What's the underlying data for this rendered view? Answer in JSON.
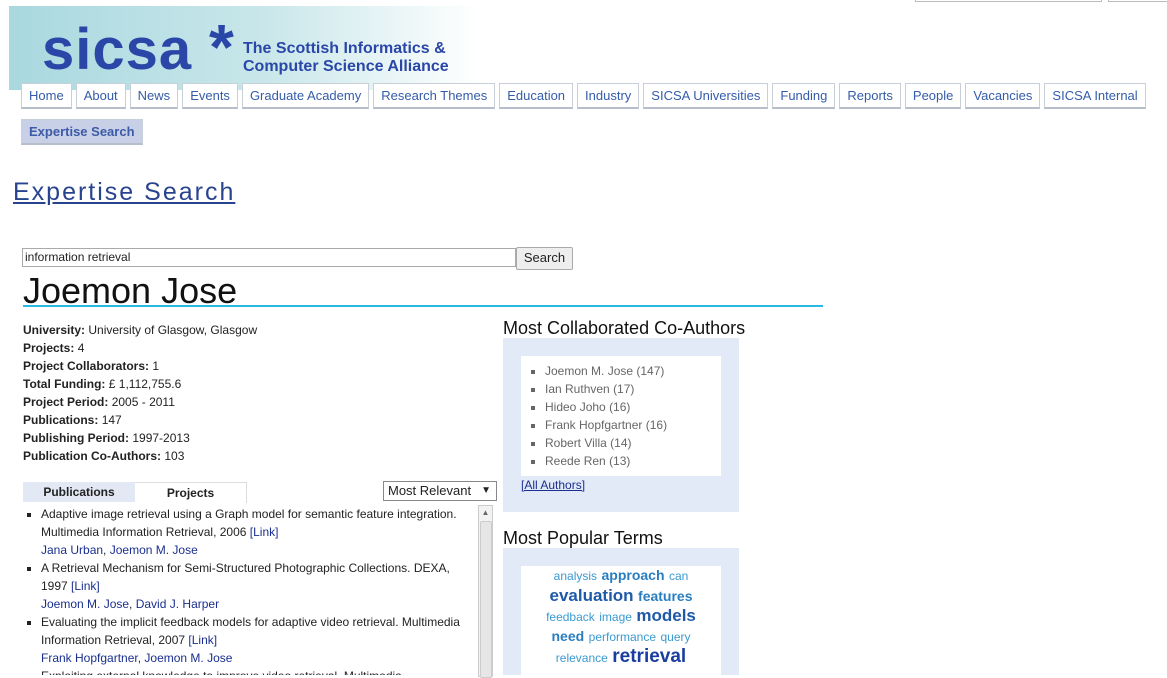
{
  "site": {
    "logo_text": "sicsa",
    "logo_star": "*",
    "tagline_1": "The Scottish Informatics &",
    "tagline_2": "Computer Science Alliance"
  },
  "nav": [
    "Home",
    "About",
    "News",
    "Events",
    "Graduate Academy",
    "Research Themes",
    "Education",
    "Industry",
    "SICSA Universities",
    "Funding",
    "Reports",
    "People",
    "Vacancies",
    "SICSA Internal"
  ],
  "nav_active": "Expertise Search",
  "page_title": "Expertise Search",
  "search": {
    "value": "information retrieval",
    "button": "Search"
  },
  "person": {
    "name": "Joemon Jose",
    "fields": [
      {
        "label": "University:",
        "value": "University of Glasgow, Glasgow"
      },
      {
        "label": "Projects:",
        "value": "4"
      },
      {
        "label": "Project Collaborators:",
        "value": "1"
      },
      {
        "label": "Total Funding:",
        "value": "£ 1,112,755.6"
      },
      {
        "label": "Project Period:",
        "value": "2005 - 2011"
      },
      {
        "label": "Publications:",
        "value": "147"
      },
      {
        "label": "Publishing Period:",
        "value": "1997-2013"
      },
      {
        "label": "Publication Co-Authors:",
        "value": "103"
      }
    ]
  },
  "tabs": {
    "publications": "Publications",
    "projects": "Projects"
  },
  "sort": {
    "selected": "Most Relevant"
  },
  "publications": [
    {
      "text": "Adaptive image retrieval using a Graph model for semantic feature integration. Multimedia Information Retrieval, 2006",
      "link": "[Link]",
      "authors": [
        "Jana Urban",
        "Joemon M. Jose"
      ]
    },
    {
      "text": "A Retrieval Mechanism for Semi-Structured Photographic Collections. DEXA, 1997",
      "link": "[Link]",
      "authors": [
        "Joemon M. Jose",
        "David J. Harper"
      ]
    },
    {
      "text": "Evaluating the implicit feedback models for adaptive video retrieval. Multimedia Information Retrieval, 2007",
      "link": "[Link]",
      "authors": [
        "Frank Hopfgartner",
        "Joemon M. Jose"
      ]
    },
    {
      "text": "Exploiting external knowledge to improve video retrieval. Multimedia",
      "link": "",
      "authors": []
    }
  ],
  "coauthors": {
    "title": "Most Collaborated Co-Authors",
    "items": [
      {
        "name": "Joemon M. Jose",
        "count": "(147)"
      },
      {
        "name": "Ian Ruthven",
        "count": "(17)"
      },
      {
        "name": "Hideo Joho",
        "count": "(16)"
      },
      {
        "name": "Frank Hopfgartner",
        "count": "(16)"
      },
      {
        "name": "Robert Villa",
        "count": "(14)"
      },
      {
        "name": "Reede Ren",
        "count": "(13)"
      }
    ],
    "all_link": "[All Authors]"
  },
  "terms": {
    "title": "Most Popular Terms",
    "lines": [
      [
        {
          "w": "analysis",
          "s": 1
        },
        {
          "w": "approach",
          "s": 2
        },
        {
          "w": "can",
          "s": 1
        }
      ],
      [
        {
          "w": "evaluation",
          "s": 3
        },
        {
          "w": "features",
          "s": 2
        }
      ],
      [
        {
          "w": "feedback",
          "s": 1
        },
        {
          "w": "image",
          "s": 1
        },
        {
          "w": "models",
          "s": 3
        }
      ],
      [
        {
          "w": "need",
          "s": 2
        },
        {
          "w": "performance",
          "s": 1
        },
        {
          "w": "query",
          "s": 1
        }
      ],
      [
        {
          "w": "relevance",
          "s": 1
        },
        {
          "w": "retrieval",
          "s": 4
        }
      ]
    ]
  }
}
